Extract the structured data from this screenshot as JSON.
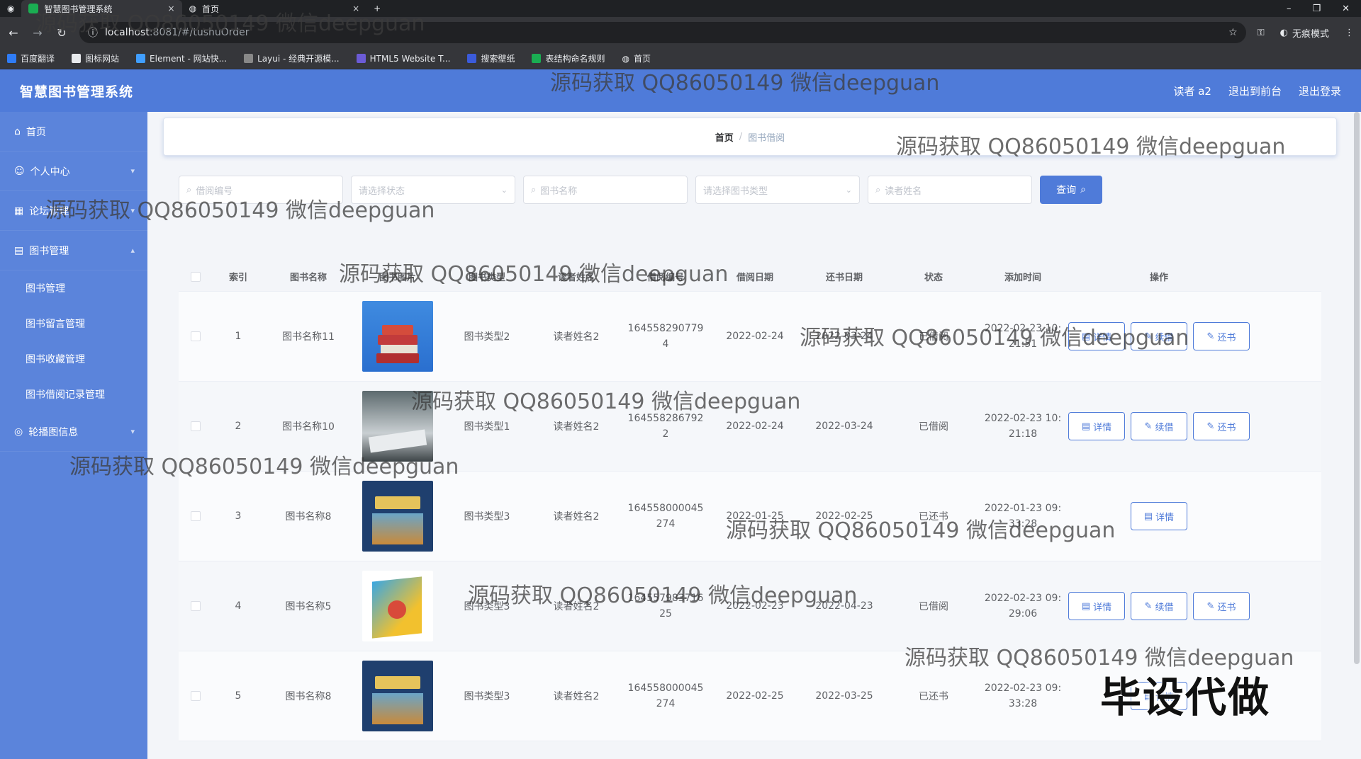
{
  "browser": {
    "tabs": [
      {
        "title": "智慧图书管理系统",
        "active": true
      },
      {
        "title": "首页",
        "active": false
      }
    ],
    "new_tab": "+",
    "tab_close": "×",
    "url_host": "localhost",
    "url_path": ":8081/#/tushuOrder",
    "incognito": "无痕模式",
    "bookmarks": [
      "百度翻译",
      "图标网站",
      "Element - 网站快...",
      "Layui - 经典开源模...",
      "HTML5 Website T...",
      "搜索壁纸",
      "表结构命名规则",
      "首页"
    ],
    "window_buttons": [
      "–",
      "❐",
      "✕"
    ]
  },
  "header": {
    "title": "智慧图书管理系统",
    "user": "读者 a2",
    "back_front": "退出到前台",
    "logout": "退出登录"
  },
  "sidebar": {
    "items": [
      {
        "label": "首页"
      },
      {
        "label": "个人中心"
      },
      {
        "label": "论坛管理"
      },
      {
        "label": "图书管理"
      }
    ],
    "sub_items": [
      {
        "label": "图书管理"
      },
      {
        "label": "图书留言管理"
      },
      {
        "label": "图书收藏管理"
      },
      {
        "label": "图书借阅记录管理"
      }
    ],
    "last_item": {
      "label": "轮播图信息"
    }
  },
  "breadcrumb": {
    "home": "首页",
    "separator": "/",
    "current": "图书借阅"
  },
  "filters": {
    "order_no_placeholder": "借阅编号",
    "status_placeholder": "请选择状态",
    "book_name_placeholder": "图书名称",
    "book_type_placeholder": "请选择图书类型",
    "reader_placeholder": "读者姓名",
    "query_label": "查询"
  },
  "table": {
    "headers": [
      "索引",
      "图书名称",
      "图书图片",
      "图书类型",
      "读者姓名",
      "借阅编号",
      "借阅日期",
      "还书日期",
      "状态",
      "添加时间",
      "操作"
    ],
    "rows": [
      {
        "idx": "1",
        "name": "图书名称11",
        "type": "图书类型2",
        "reader": "读者姓名2",
        "no": "1645582907794",
        "borrow": "2022-02-24",
        "return": "2022-03-24",
        "status": "已借阅",
        "added": "2022-02-23 10:21:51",
        "actions": [
          "详情",
          "续借",
          "还书"
        ],
        "cover": "red"
      },
      {
        "idx": "2",
        "name": "图书名称10",
        "type": "图书类型1",
        "reader": "读者姓名2",
        "no": "1645582867922",
        "borrow": "2022-02-24",
        "return": "2022-03-24",
        "status": "已借阅",
        "added": "2022-02-23 10:21:18",
        "actions": [
          "详情",
          "续借",
          "还书"
        ],
        "cover": "photo"
      },
      {
        "idx": "3",
        "name": "图书名称8",
        "type": "图书类型3",
        "reader": "读者姓名2",
        "no": "164558000045274",
        "borrow": "2022-01-25",
        "return": "2022-02-25",
        "status": "已还书",
        "added": "2022-01-23 09:33:28",
        "actions": [
          "详情"
        ],
        "cover": "navy"
      },
      {
        "idx": "4",
        "name": "图书名称5",
        "type": "图书类型3",
        "reader": "读者姓名2",
        "no": "164557983716 25",
        "borrow": "2022-02-23",
        "return": "2022-04-23",
        "status": "已借阅",
        "added": "2022-02-23 09:29:06",
        "actions": [
          "详情",
          "续借",
          "还书"
        ],
        "cover": "box"
      },
      {
        "idx": "5",
        "name": "图书名称8",
        "type": "图书类型3",
        "reader": "读者姓名2",
        "no": "164558000045274",
        "borrow": "2022-02-25",
        "return": "2022-03-25",
        "status": "已还书",
        "added": "2022-02-23 09:33:28",
        "actions": [
          "详情"
        ],
        "cover": "navy"
      }
    ]
  },
  "overlay": {
    "watermark": "源码获取 QQ86050149 微信deepguan",
    "badge": "毕设代做"
  },
  "colors": {
    "primary": "#4f7bd9",
    "sidebar": "#5b84db"
  }
}
